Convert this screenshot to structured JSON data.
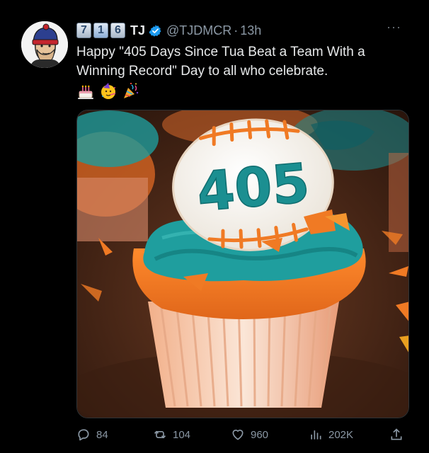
{
  "tweet": {
    "display_name": "TJ",
    "badges": [
      "7",
      "1",
      "6"
    ],
    "handle": "@TJDMCR",
    "separator": "·",
    "time": "13h",
    "text": "Happy \"405 Days Since Tua Beat a Team With a Winning Record\" Day to all who celebrate.",
    "emojis": [
      "cake-emoji",
      "partying-face-emoji",
      "party-popper-emoji"
    ],
    "image": {
      "cake_number": "405",
      "colors": {
        "teal": "#1e9e9e",
        "orange": "#f07a24",
        "white": "#f4f1ec"
      }
    }
  },
  "actions": {
    "replies": "84",
    "retweets": "104",
    "likes": "960",
    "views": "202K"
  },
  "colors": {
    "background": "#000000",
    "text": "#e7e9ea",
    "muted": "#8b98a5",
    "verified": "#1d9bf0"
  }
}
